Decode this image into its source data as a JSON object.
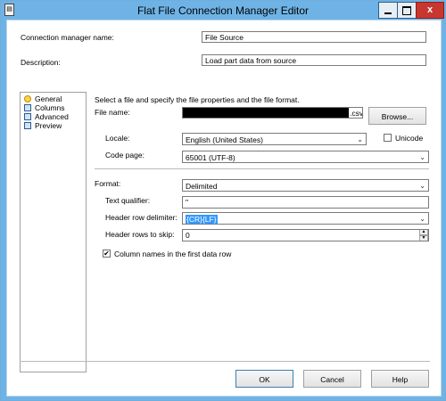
{
  "window": {
    "title": "Flat File Connection Manager Editor",
    "system_icon": "app-icon",
    "minimize_label": "",
    "maximize_label": "",
    "close_label": "x"
  },
  "form": {
    "connection_manager_name_label": "Connection manager name:",
    "connection_manager_name_value": "File Source",
    "description_label": "Description:",
    "description_value": "Load part data from source"
  },
  "nav": {
    "items": [
      {
        "label": "General",
        "icon": "general-icon"
      },
      {
        "label": "Columns",
        "icon": "columns-icon"
      },
      {
        "label": "Advanced",
        "icon": "advanced-icon"
      },
      {
        "label": "Preview",
        "icon": "preview-icon"
      }
    ]
  },
  "general": {
    "intro": "Select a file and specify the file properties and the file format.",
    "file_name_label": "File name:",
    "file_name_suffix": ".csv",
    "browse_label": "Browse...",
    "locale_label": "Locale:",
    "locale_value": "English (United States)",
    "unicode_label": "Unicode",
    "unicode_checked": false,
    "code_page_label": "Code page:",
    "code_page_value": "65001 (UTF-8)",
    "format_label": "Format:",
    "format_value": "Delimited",
    "text_qualifier_label": "Text qualifier:",
    "text_qualifier_value": "\"",
    "header_row_delimiter_label": "Header row delimiter:",
    "header_row_delimiter_value": "{CR}{LF}",
    "header_rows_to_skip_label": "Header rows to skip:",
    "header_rows_to_skip_value": "0",
    "column_names_label": "Column names in the first data row",
    "column_names_checked": true
  },
  "footer": {
    "ok_label": "OK",
    "cancel_label": "Cancel",
    "help_label": "Help"
  },
  "colors": {
    "titlebar": "#6fb3e6",
    "close_button": "#c7372f",
    "selection": "#3399ff"
  }
}
